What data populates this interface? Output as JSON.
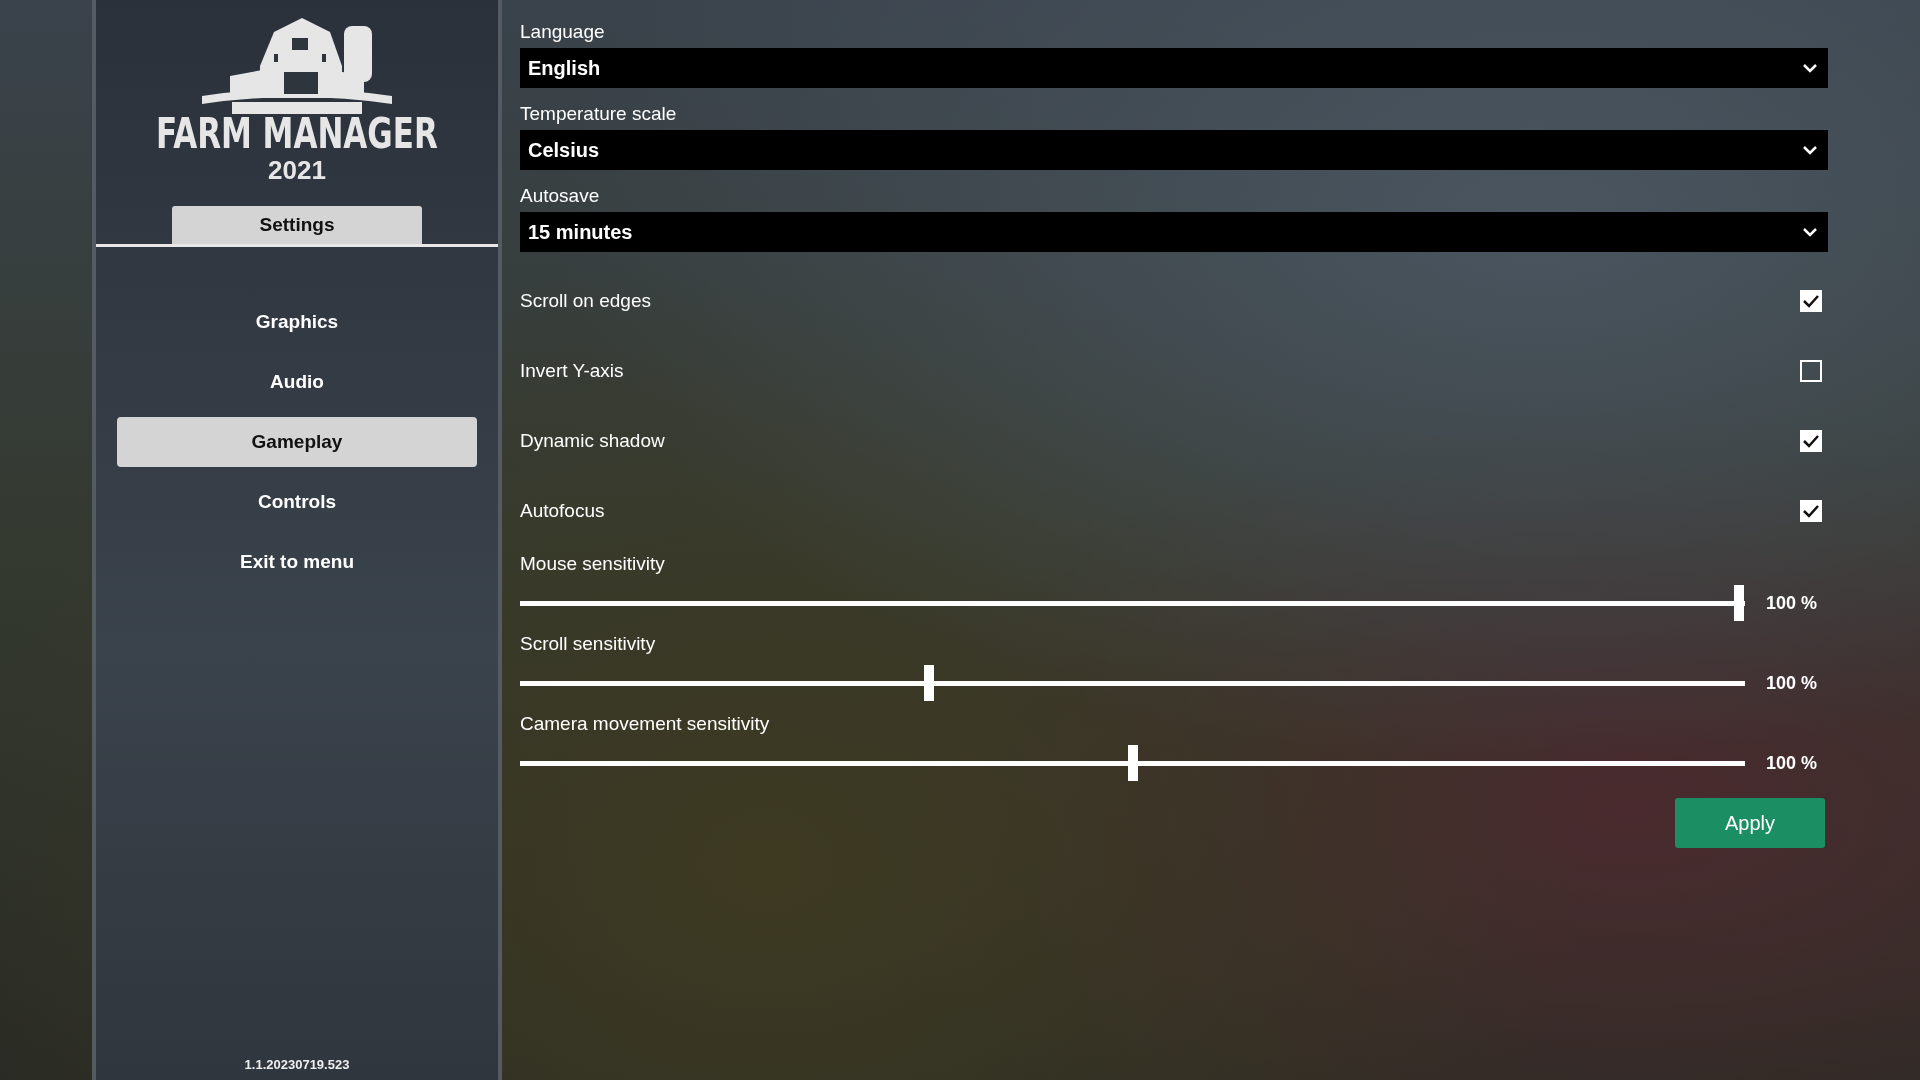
{
  "sidebar": {
    "logo": {
      "title": "FARM MANAGER",
      "year": "2021"
    },
    "header_tab": {
      "label": "Settings",
      "selected": true
    },
    "items": [
      {
        "label": "Graphics",
        "selected": false
      },
      {
        "label": "Audio",
        "selected": false
      },
      {
        "label": "Gameplay",
        "selected": true
      },
      {
        "label": "Controls",
        "selected": false
      },
      {
        "label": "Exit to menu",
        "selected": false
      }
    ],
    "version": "1.1.20230719.523"
  },
  "settings": [
    {
      "kind": "dropdown",
      "label": "Language",
      "value": "English"
    },
    {
      "kind": "dropdown",
      "label": "Temperature scale",
      "value": "Celsius"
    },
    {
      "kind": "dropdown",
      "label": "Autosave",
      "value": "15 minutes"
    },
    {
      "kind": "checkbox",
      "label": "Scroll on edges",
      "checked": true
    },
    {
      "kind": "checkbox",
      "label": "Invert Y-axis",
      "checked": false
    },
    {
      "kind": "checkbox",
      "label": "Dynamic shadow",
      "checked": true
    },
    {
      "kind": "checkbox",
      "label": "Autofocus",
      "checked": true
    },
    {
      "kind": "slider",
      "label": "Mouse sensitivity",
      "level": 0.995,
      "reading": "100 %"
    },
    {
      "kind": "slider",
      "label": "Scroll sensitivity",
      "level": 0.334,
      "reading": "100 %"
    },
    {
      "kind": "slider",
      "label": "Camera movement sensitivity",
      "level": 0.5,
      "reading": "100 %"
    }
  ],
  "apply_button": "Apply"
}
